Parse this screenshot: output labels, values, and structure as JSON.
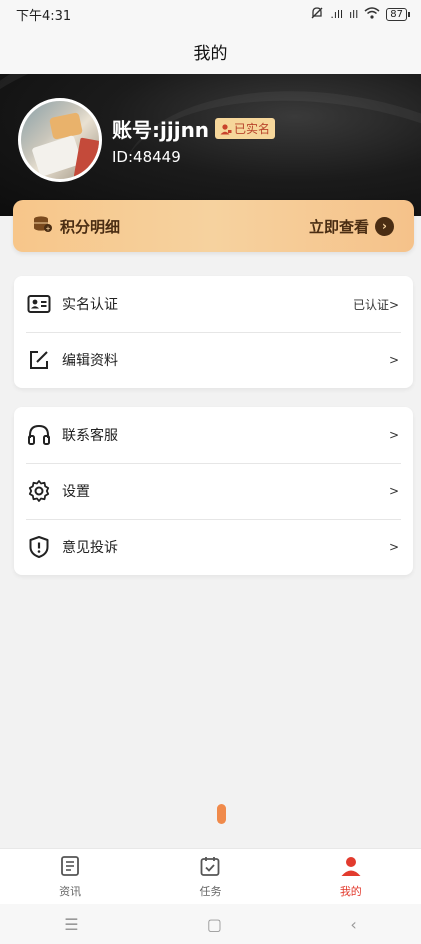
{
  "status_bar": {
    "time": "下午4:31",
    "signal1": ".ıll",
    "signal2": "ıll",
    "battery": "87"
  },
  "header": {
    "title": "我的"
  },
  "profile": {
    "account": "账号:jjjnn",
    "verified_badge": "已实名",
    "user_id": "ID:48449"
  },
  "points": {
    "label": "积分明细",
    "action": "立即查看"
  },
  "menu_group1": [
    {
      "label": "实名认证",
      "value": "已认证>"
    },
    {
      "label": "编辑资料",
      "value": ">"
    }
  ],
  "menu_group2": [
    {
      "label": "联系客服",
      "value": ">"
    },
    {
      "label": "设置",
      "value": ">"
    },
    {
      "label": "意见投诉",
      "value": ">"
    }
  ],
  "tabbar": [
    {
      "label": "资讯",
      "icon": "document-icon"
    },
    {
      "label": "任务",
      "icon": "calendar-check-icon"
    },
    {
      "label": "我的",
      "icon": "user-icon",
      "active": true
    }
  ],
  "colors": {
    "accent": "#e23b2e",
    "gold": "#f6d29f",
    "scroll": "#f08a4b"
  }
}
